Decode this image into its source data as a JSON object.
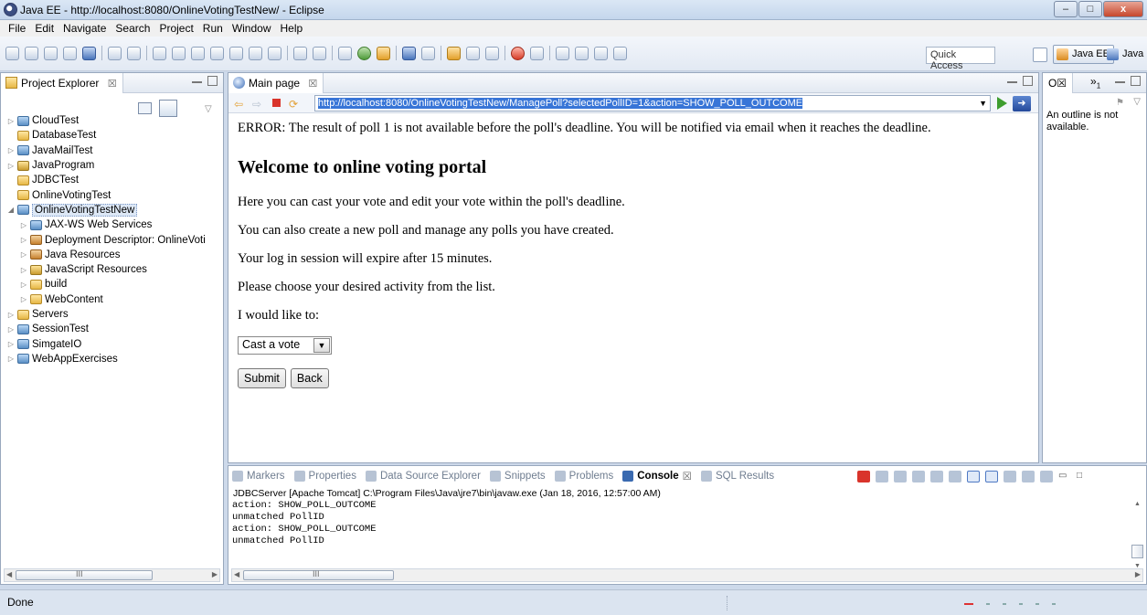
{
  "window": {
    "title": "Java EE - http://localhost:8080/OnlineVotingTestNew/ - Eclipse",
    "buttons": {
      "minimize": "–",
      "maximize": "□",
      "close": "x"
    }
  },
  "menu": [
    "File",
    "Edit",
    "Navigate",
    "Search",
    "Project",
    "Run",
    "Window",
    "Help"
  ],
  "toolbar": {
    "quick_access_placeholder": "Quick Access",
    "perspective_active": "Java EE",
    "perspective_other": "Java"
  },
  "explorer": {
    "tab_title": "Project Explorer",
    "close": "☒",
    "items": [
      {
        "label": "CloudTest",
        "icon": "web-project-icon"
      },
      {
        "label": "DatabaseTest",
        "icon": "folder-icon"
      },
      {
        "label": "JavaMailTest",
        "icon": "web-project-icon"
      },
      {
        "label": "JavaProgram",
        "icon": "java-project-icon"
      },
      {
        "label": "JDBCTest",
        "icon": "folder-icon"
      },
      {
        "label": "OnlineVotingTest",
        "icon": "folder-icon"
      },
      {
        "label": "OnlineVotingTestNew",
        "icon": "web-project-icon"
      },
      {
        "label": "JAX-WS Web Services",
        "icon": "web-services-icon"
      },
      {
        "label": "Deployment Descriptor: OnlineVoti",
        "icon": "deployment-descriptor-icon"
      },
      {
        "label": "Java Resources",
        "icon": "java-resources-icon"
      },
      {
        "label": "JavaScript Resources",
        "icon": "javascript-resources-icon"
      },
      {
        "label": "build",
        "icon": "folder-icon"
      },
      {
        "label": "WebContent",
        "icon": "folder-icon"
      },
      {
        "label": "Servers",
        "icon": "folder-icon"
      },
      {
        "label": "SessionTest",
        "icon": "web-project-icon"
      },
      {
        "label": "SimgateIO",
        "icon": "web-project-icon"
      },
      {
        "label": "WebAppExercises",
        "icon": "web-project-icon"
      }
    ],
    "scroll_mark": "III"
  },
  "browser": {
    "tab_title": "Main page",
    "close": "☒",
    "url": "http://localhost:8080/OnlineVotingTestNew/ManagePoll?selectedPollID=1&action=SHOW_POLL_OUTCOME",
    "page": {
      "error": "ERROR: The result of poll 1 is not available before the poll's deadline. You will be notified via email when it reaches the deadline.",
      "heading": "Welcome to online voting portal",
      "p1": "Here you can cast your vote and edit your vote within the poll's deadline.",
      "p2": "You can also create a new poll and manage any polls you have created.",
      "p3": "Your log in session will expire after 15 minutes.",
      "p4": "Please choose your desired activity from the list.",
      "p5": "I would like to:",
      "select_value": "Cast a vote",
      "submit": "Submit",
      "back": "Back"
    }
  },
  "outline": {
    "tab_title": "O☒",
    "chevron": "»",
    "count": "1",
    "message": "An outline is not available."
  },
  "console": {
    "tabs": [
      "Markers",
      "Properties",
      "Data Source Explorer",
      "Snippets",
      "Problems",
      "Console",
      "SQL Results"
    ],
    "active_tab": "Console",
    "server_line": "JDBCServer [Apache Tomcat] C:\\Program Files\\Java\\jre7\\bin\\javaw.exe (Jan 18, 2016, 12:57:00 AM)",
    "lines": [
      "action: SHOW_POLL_OUTCOME",
      "unmatched PollID",
      "action: SHOW_POLL_OUTCOME",
      "unmatched PollID"
    ],
    "scroll_mark": "III"
  },
  "status": {
    "text": "Done"
  },
  "colors": {
    "accent": "#3875d7",
    "stop": "#d9342b",
    "go": "#3e9d2f"
  }
}
